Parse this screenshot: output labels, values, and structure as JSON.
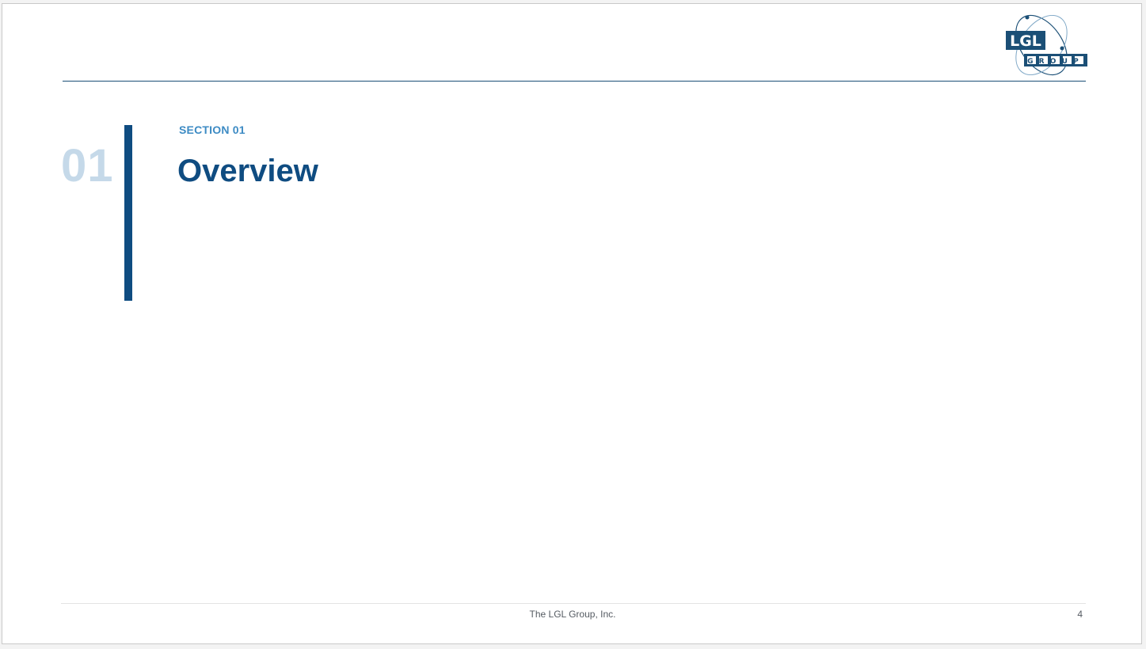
{
  "slide": {
    "section_number": "01",
    "section_label": "SECTION 01",
    "title": "Overview"
  },
  "logo": {
    "icon": "lgl-group-logo",
    "top_text": "LGL",
    "bottom_text": "GROUP"
  },
  "footer": {
    "company": "The LGL Group, Inc.",
    "page_number": "4"
  },
  "colors": {
    "primary": "#0f4c81",
    "accent": "#3d8bc4",
    "number_tint": "#c5d9e9"
  }
}
